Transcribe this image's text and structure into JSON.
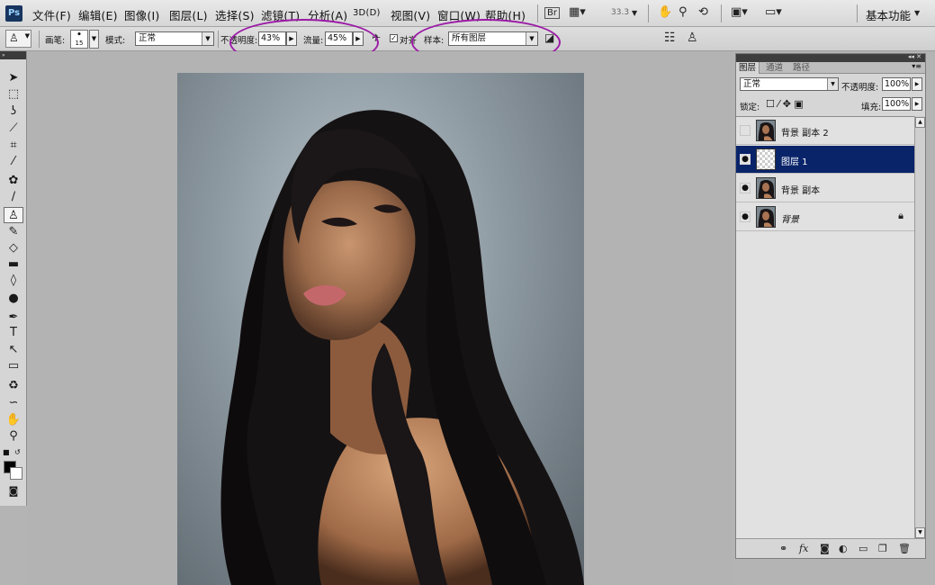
{
  "menu": {
    "logo": "Ps",
    "items": [
      "文件(F)",
      "编辑(E)",
      "图像(I)",
      "图层(L)",
      "选择(S)",
      "滤镜(T)",
      "分析(A)",
      "3D(D)",
      "视图(V)",
      "窗口(W)",
      "帮助(H)"
    ],
    "zoom": "33.3",
    "workspace": "基本功能"
  },
  "options": {
    "brush_label": "画笔:",
    "brush_size": "15",
    "mode_label": "模式:",
    "mode_value": "正常",
    "opacity_label": "不透明度:",
    "opacity_value": "43%",
    "flow_label": "流量:",
    "flow_value": "45%",
    "aligned_label": "对齐",
    "sample_label": "样本:",
    "sample_value": "所有图层"
  },
  "layers_panel": {
    "tabs": [
      "图层",
      "通道",
      "路径"
    ],
    "blend_mode": "正常",
    "opacity_label": "不透明度:",
    "opacity_value": "100%",
    "lock_label": "锁定:",
    "fill_label": "填充:",
    "fill_value": "100%",
    "layers": [
      {
        "name": "背景 副本 2",
        "visible": false,
        "selected": false,
        "thumb": "photo"
      },
      {
        "name": "图层 1",
        "visible": true,
        "selected": true,
        "thumb": "transparent"
      },
      {
        "name": "背景 副本",
        "visible": true,
        "selected": false,
        "thumb": "photo"
      },
      {
        "name": "背景",
        "visible": true,
        "selected": false,
        "thumb": "photo",
        "locked": true
      }
    ]
  },
  "colors": {
    "accent_selected": "#0a246a",
    "annotation_oval": "#9b1aa6"
  }
}
